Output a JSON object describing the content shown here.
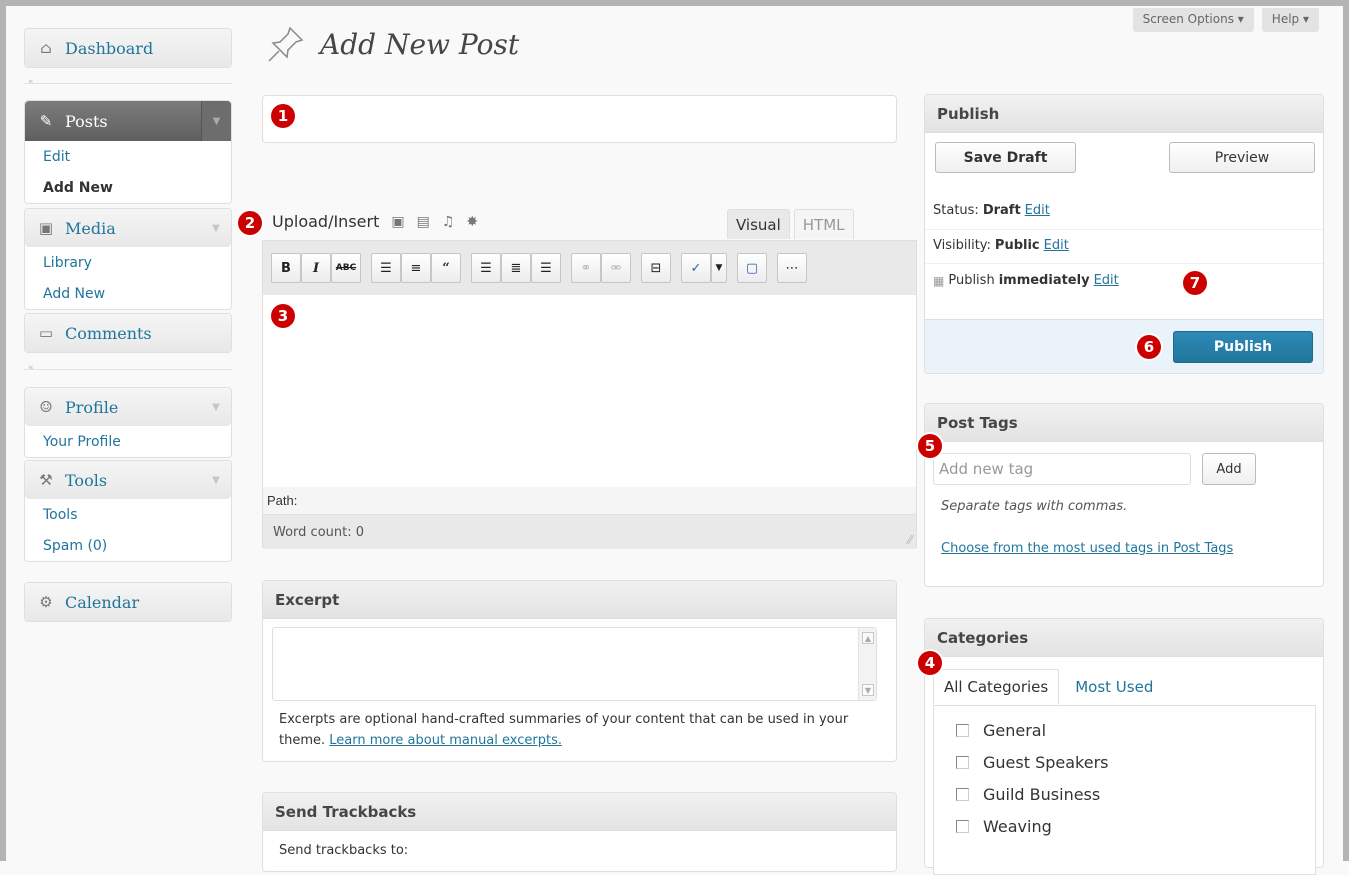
{
  "header": {
    "screen_options": "Screen Options",
    "help": "Help",
    "page_title": "Add New Post"
  },
  "sidebar": {
    "dashboard": "Dashboard",
    "posts": {
      "label": "Posts",
      "items": [
        "Edit",
        "Add New"
      ]
    },
    "media": {
      "label": "Media",
      "items": [
        "Library",
        "Add New"
      ]
    },
    "comments": "Comments",
    "profile": {
      "label": "Profile",
      "items": [
        "Your Profile"
      ]
    },
    "tools": {
      "label": "Tools",
      "items": [
        "Tools",
        "Spam (0)"
      ]
    },
    "calendar": "Calendar"
  },
  "markers": [
    "1",
    "2",
    "3",
    "4",
    "5",
    "6",
    "7"
  ],
  "editor": {
    "title_value": "",
    "upload_insert": "Upload/Insert",
    "tab_visual": "Visual",
    "tab_html": "HTML",
    "toolbar": [
      "B",
      "I",
      "ABC"
    ],
    "path": "Path:",
    "word_count": "Word count: 0"
  },
  "excerpt": {
    "title": "Excerpt",
    "help_text": "Excerpts are optional hand-crafted summaries of your content that can be used in your theme.",
    "help_link": "Learn more about manual excerpts."
  },
  "trackbacks": {
    "title": "Send Trackbacks",
    "label": "Send trackbacks to:"
  },
  "publish": {
    "title": "Publish",
    "save_draft": "Save Draft",
    "preview": "Preview",
    "status_label": "Status:",
    "status_value": "Draft",
    "visibility_label": "Visibility:",
    "visibility_value": "Public",
    "schedule_label": "Publish",
    "schedule_value": "immediately",
    "edit": "Edit",
    "publish_button": "Publish"
  },
  "tags": {
    "title": "Post Tags",
    "placeholder": "Add new tag",
    "add_button": "Add",
    "help": "Separate tags with commas.",
    "most_used_link": "Choose from the most used tags in Post Tags"
  },
  "categories": {
    "title": "Categories",
    "tab_all": "All Categories",
    "tab_most_used": "Most Used",
    "items": [
      "General",
      "Guest Speakers",
      "Guild Business",
      "Weaving"
    ]
  },
  "colors": {
    "link": "#21759b",
    "marker": "#cc0000",
    "primary": "#21759b"
  }
}
